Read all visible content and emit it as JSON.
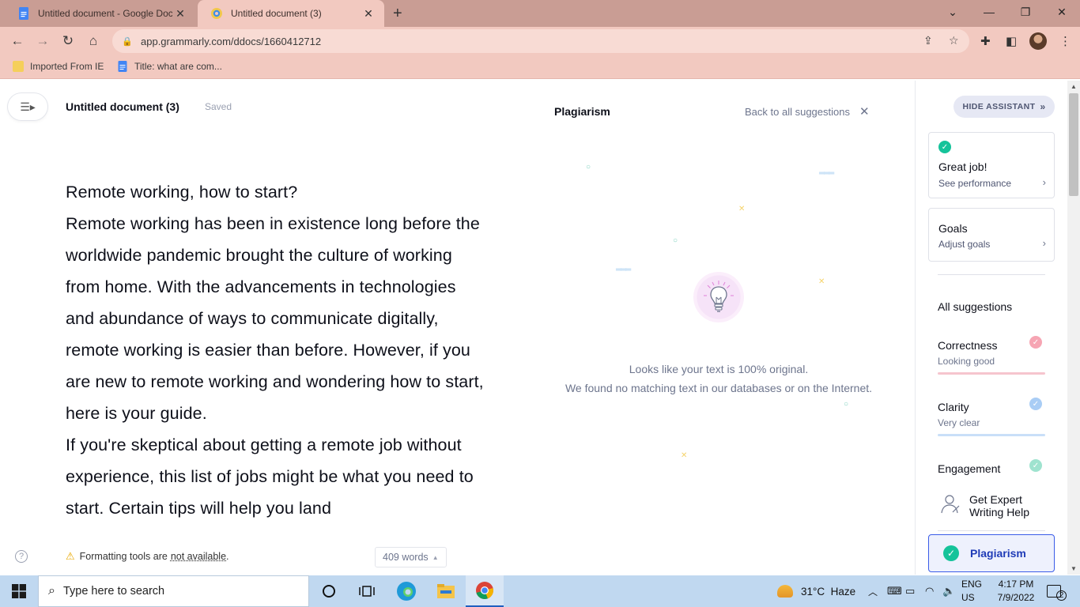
{
  "browser": {
    "tabs": [
      {
        "title": "Untitled document - Google Docs",
        "active": false
      },
      {
        "title": "Untitled document (3)",
        "active": true
      }
    ],
    "url": "app.grammarly.com/ddocs/1660412712",
    "bookmarks": [
      {
        "label": "Imported From IE",
        "icon": "folder-icon"
      },
      {
        "label": "Title: what are com...",
        "icon": "docs-icon"
      }
    ]
  },
  "editor": {
    "doc_title": "Untitled document (3)",
    "save_status": "Saved",
    "paragraphs": [
      "Remote working, how to start?",
      "Remote working has been in existence long before the worldwide pandemic brought the culture of working from home. With the advancements in technologies and abundance of ways to communicate digitally, remote working is easier than before. However, if you are new to remote working and wondering how to start, here is your guide.",
      "If you're skeptical about getting a remote job without experience, this list of jobs might be what you need to start. Certain tips will help you land"
    ],
    "footer": {
      "format_text": "Formatting tools are",
      "format_link": "not available",
      "format_end": ".",
      "word_count": "409 words"
    }
  },
  "plagiarism": {
    "title": "Plagiarism",
    "back_label": "Back to all suggestions",
    "result_line1": "Looks like your text is 100% original.",
    "result_line2": "We found no matching text in our databases or on the Internet."
  },
  "assistant": {
    "hide_label": "HIDE ASSISTANT",
    "performance": {
      "title": "Great job!",
      "link": "See performance"
    },
    "goals": {
      "title": "Goals",
      "link": "Adjust goals"
    },
    "all_suggestions": "All suggestions",
    "categories": [
      {
        "name": "Correctness",
        "status": "Looking good",
        "color": "#f6a5b3"
      },
      {
        "name": "Clarity",
        "status": "Very clear",
        "color": "#a9cdf5"
      },
      {
        "name": "Engagement",
        "status": "",
        "color": "#9fe3cf"
      }
    ],
    "expert": "Get Expert Writing Help",
    "plagiarism_button": "Plagiarism"
  },
  "taskbar": {
    "search_placeholder": "Type here to search",
    "weather": "31°C  Haze",
    "lang_line1": "ENG",
    "lang_line2": "US",
    "time": "4:17 PM",
    "date": "7/9/2022",
    "notifications": "2"
  },
  "colors": {
    "grammarly_green": "#15c39a",
    "grammarly_blue": "#1f3bb7",
    "tab_strip": "#c99d94"
  }
}
